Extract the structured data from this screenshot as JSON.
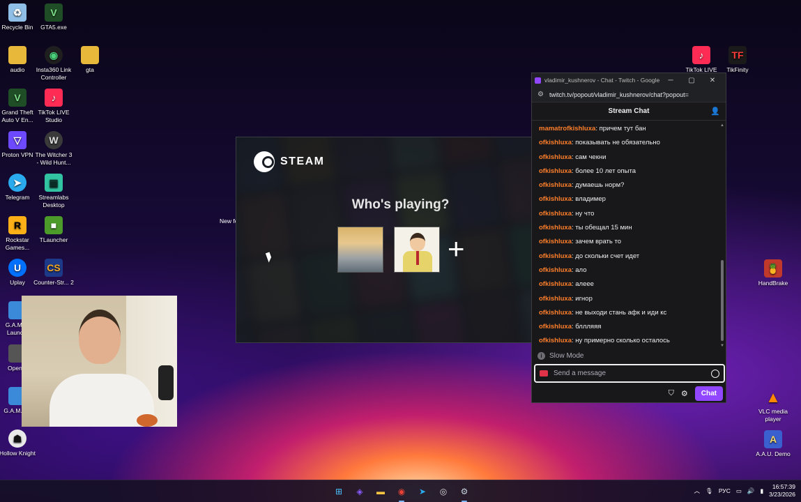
{
  "desktop": {
    "icons": [
      {
        "label": "Recycle Bin",
        "icon": "recycle-bin-icon",
        "color": "#8fbfe6"
      },
      {
        "label": "GTA5.exe",
        "icon": "gta-v-icon",
        "color": "#2f8f3a"
      },
      {
        "label": "audio",
        "icon": "folder-icon",
        "color": "#e8b83a"
      },
      {
        "label": "Insta360 Link Controller",
        "icon": "insta360-icon",
        "color": "#1f1f1f"
      },
      {
        "label": "gta",
        "icon": "folder-icon",
        "color": "#e8b83a"
      },
      {
        "label": "Grand Theft Auto V En...",
        "icon": "gta-v-icon",
        "color": "#2f8f3a"
      },
      {
        "label": "TikTok LIVE Studio",
        "icon": "tiktok-icon",
        "color": "#fe2c55"
      },
      {
        "label": "Proton VPN",
        "icon": "proton-vpn-icon",
        "color": "#6d4aff"
      },
      {
        "label": "The Witcher 3 - Wild Hunt...",
        "icon": "witcher-icon",
        "color": "#3a3a3a"
      },
      {
        "label": "Telegram",
        "icon": "telegram-icon",
        "color": "#2aabee"
      },
      {
        "label": "Streamlabs Desktop",
        "icon": "streamlabs-icon",
        "color": "#31c3a2"
      },
      {
        "label": "Rockstar Games...",
        "icon": "rockstar-icon",
        "color": "#fcaf17"
      },
      {
        "label": "TLauncher",
        "icon": "tlauncher-icon",
        "color": "#4c9a2a"
      },
      {
        "label": "Uplay",
        "icon": "uplay-icon",
        "color": "#0070ff"
      },
      {
        "label": "Counter-Str... 2",
        "icon": "cs2-icon",
        "color": "#1d3a8a"
      },
      {
        "label": "G.A.M.E. Launc...",
        "icon": "app-icon",
        "color": "#3b8ad9"
      },
      {
        "label": "Open...",
        "icon": "app-icon",
        "color": "#555555"
      },
      {
        "label": "G.A.M.E...",
        "icon": "app-icon",
        "color": "#3b8ad9"
      },
      {
        "label": "Hollow Knight",
        "icon": "hollow-knight-icon",
        "color": "#e9e9e9"
      },
      {
        "label": "TikTok LIVE",
        "icon": "tiktok-icon",
        "color": "#fe2c55"
      },
      {
        "label": "TikFinity",
        "icon": "tikfinity-icon",
        "color": "#ff3b3b"
      },
      {
        "label": "HandBrake",
        "icon": "handbrake-icon",
        "color": "#c0392b"
      },
      {
        "label": "VLC media player",
        "icon": "vlc-icon",
        "color": "#ff8800"
      },
      {
        "label": "A.A.U. Demo",
        "icon": "app-icon",
        "color": "#3a5fcf"
      }
    ],
    "partial_label": "New fo"
  },
  "steam": {
    "brand": "STEAM",
    "title": "Who's playing?",
    "add_label": "+"
  },
  "chat_window": {
    "title": "vladimir_kushnerov - Chat - Twitch - Google C...",
    "url": "twitch.tv/popout/vladimir_kushnerov/chat?popout=",
    "header": "Stream Chat",
    "messages": [
      {
        "user": "mamatrofkishluxa",
        "text": ": причем тут бан"
      },
      {
        "user": "ofkishluxa",
        "text": ": показывать не обязательно"
      },
      {
        "user": "ofkishluxa",
        "text": ": сам чекни"
      },
      {
        "user": "ofkishluxa",
        "text": ": более 10 лет опыта"
      },
      {
        "user": "ofkishluxa",
        "text": ": думаешь норм?"
      },
      {
        "user": "ofkishluxa",
        "text": ": владимер"
      },
      {
        "user": "ofkishluxa",
        "text": ": ну что"
      },
      {
        "user": "ofkishluxa",
        "text": ": ты обещал 15 мин"
      },
      {
        "user": "ofkishluxa",
        "text": ": зачем врать то"
      },
      {
        "user": "ofkishluxa",
        "text": ": до скольки счет идет"
      },
      {
        "user": "ofkishluxa",
        "text": ": ало"
      },
      {
        "user": "ofkishluxa",
        "text": ": алеее"
      },
      {
        "user": "ofkishluxa",
        "text": ": игнор"
      },
      {
        "user": "ofkishluxa",
        "text": ": не выходи стань афк и иди кс"
      },
      {
        "user": "ofkishluxa",
        "text": ": бллляяя"
      },
      {
        "user": "ofkishluxa",
        "text": ": ну примерно сколько осталось"
      }
    ],
    "slow_mode": "Slow Mode",
    "input_placeholder": "Send a message",
    "send_label": "Chat"
  },
  "taskbar": {
    "apps": [
      {
        "icon": "windows-start-icon",
        "color": "#4cc2ff"
      },
      {
        "icon": "copilot-icon",
        "color": "#8a5cff"
      },
      {
        "icon": "file-explorer-icon",
        "color": "#f5c542"
      },
      {
        "icon": "chrome-icon",
        "color": "#e94235"
      },
      {
        "icon": "telegram-icon",
        "color": "#2aabee"
      },
      {
        "icon": "obs-icon",
        "color": "#dddddd"
      },
      {
        "icon": "steam-icon",
        "color": "#c7d5e0"
      }
    ],
    "language": "РУС",
    "time": "16:57:39",
    "date": "3/23/2026"
  }
}
